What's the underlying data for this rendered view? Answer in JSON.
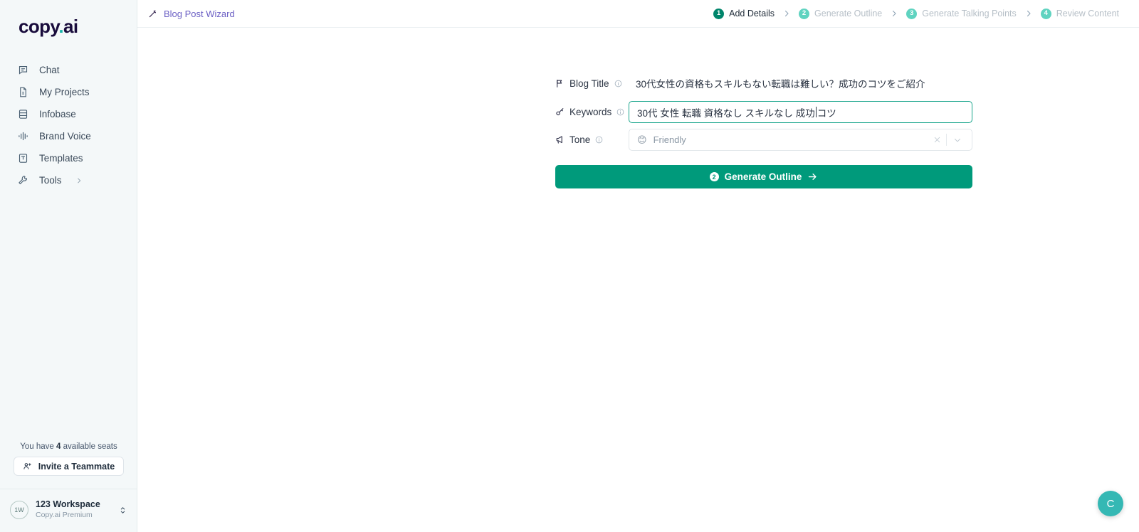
{
  "brand": {
    "logo_main": "copy",
    "logo_dot": ".",
    "logo_suffix": "ai",
    "accent_teal": "#18b3a8",
    "accent_green": "#009a7b",
    "logo_navy": "#190c3c"
  },
  "sidebar": {
    "items": [
      {
        "label": "Chat",
        "icon": "chat-bubble-icon"
      },
      {
        "label": "My Projects",
        "icon": "document-icon"
      },
      {
        "label": "Infobase",
        "icon": "database-icon"
      },
      {
        "label": "Brand Voice",
        "icon": "waveform-icon"
      },
      {
        "label": "Templates",
        "icon": "template-icon"
      },
      {
        "label": "Tools",
        "icon": "wrench-icon",
        "chevron": true
      }
    ],
    "seats_prefix": "You have ",
    "seats_count": "4",
    "seats_suffix": " available seats",
    "invite_label": "Invite a Teammate",
    "workspace": {
      "avatar_initials": "1W",
      "name": "123 Workspace",
      "plan": "Copy.ai Premium"
    }
  },
  "topbar": {
    "wizard_title": "Blog Post Wizard",
    "steps": [
      {
        "number": "1",
        "label": "Add Details",
        "state": "active"
      },
      {
        "number": "2",
        "label": "Generate Outline",
        "state": "inactive"
      },
      {
        "number": "3",
        "label": "Generate Talking Points",
        "state": "inactive"
      },
      {
        "number": "4",
        "label": "Review Content",
        "state": "inactive"
      }
    ]
  },
  "form": {
    "blog_title": {
      "label": "Blog Title",
      "value": "30代女性の資格もスキルもない転職は難しい？成功のコツをご紹介"
    },
    "keywords": {
      "label": "Keywords",
      "value_before_caret": "30代 女性 転職 資格なし スキルなし 成功 ",
      "value_after_caret": "コツ",
      "placeholder": "Keywords"
    },
    "tone": {
      "label": "Tone",
      "emoji": "😊",
      "value": "Friendly",
      "clear_label": "×"
    },
    "generate_button": {
      "step_number": "2",
      "label": "Generate Outline"
    }
  },
  "fab": {
    "label": "C"
  }
}
